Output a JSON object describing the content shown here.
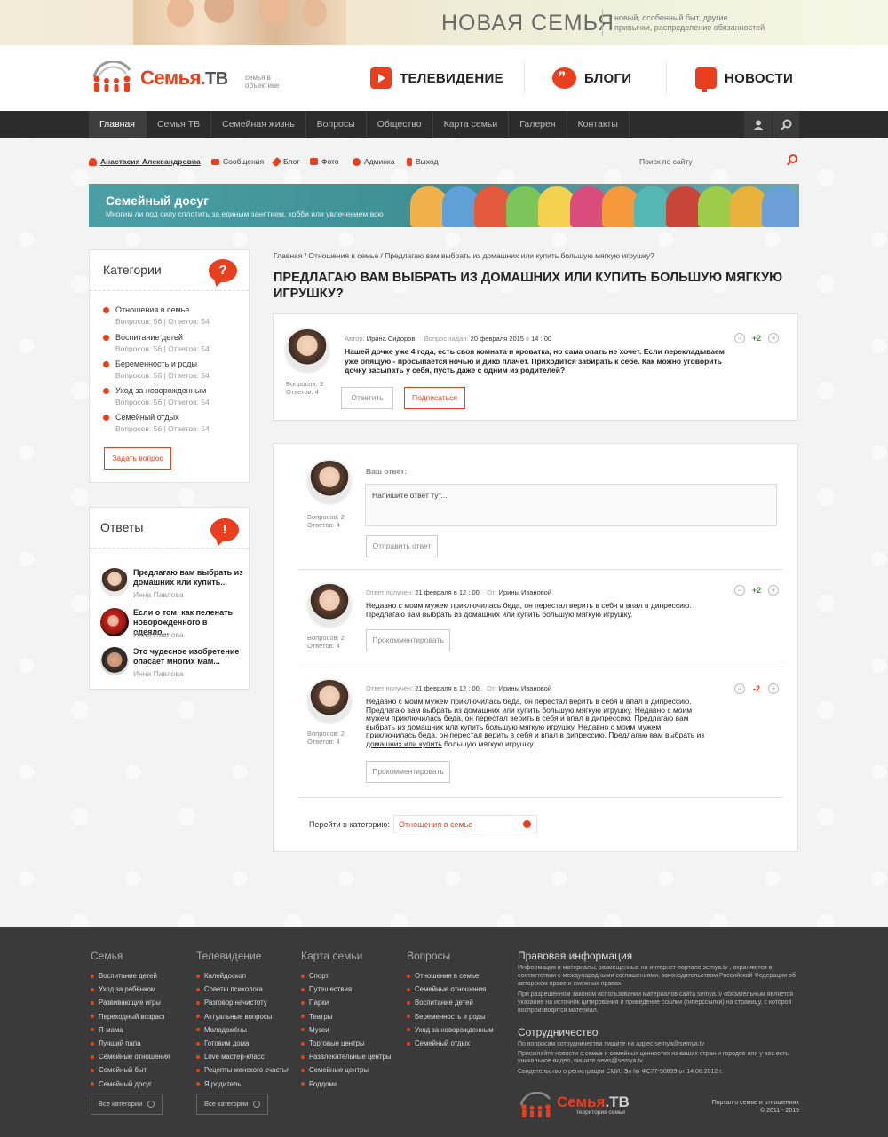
{
  "top_banner": {
    "title": "НОВАЯ СЕМЬЯ",
    "subtitle": "новый, особенный быт, другие привычки, распределение обязанностей"
  },
  "logo": {
    "brand": "Семья",
    "suffix": ".ТВ",
    "slogan": "семья в объективе"
  },
  "header_nav": [
    {
      "label": "ТЕЛЕВИДЕНИЕ",
      "icon": "tv-play-icon"
    },
    {
      "label": "БЛОГИ",
      "icon": "quote-bubble-icon"
    },
    {
      "label": "НОВОСТИ",
      "icon": "megaphone-icon"
    }
  ],
  "menu": [
    "Главная",
    "Семья ТВ",
    "Семейная жизнь",
    "Вопросы",
    "Общество",
    "Карта семьи",
    "Галерея",
    "Контакты"
  ],
  "user_bar": {
    "user": "Анастасия Александровна",
    "links": [
      "Сообщения",
      "Блог",
      "Фото",
      "Админка",
      "Выход"
    ],
    "search_placeholder": "Поиск по сайту"
  },
  "promo": {
    "title": "Семейный досуг",
    "subtitle": "Многим ли под силу сплотить за единым занятием, хобби или увлечением всю"
  },
  "categories": {
    "title": "Категории",
    "items": [
      {
        "name": "Отношения в семье",
        "stats": "Вопросов: 56 | Ответов: 54"
      },
      {
        "name": "Воспитание детей",
        "stats": "Вопросов: 56 | Ответов: 54"
      },
      {
        "name": "Беременность и роды",
        "stats": "Вопросов: 56 | Ответов: 54"
      },
      {
        "name": "Уход за новорожденным",
        "stats": "Вопросов: 56 | Ответов: 54"
      },
      {
        "name": "Семейный отдых",
        "stats": "Вопросов: 56 | Ответов: 54"
      }
    ],
    "ask_button": "Задать вопрос"
  },
  "answers_box": {
    "title": "Ответы",
    "items": [
      {
        "question": "Предлагаю вам выбрать из домашних или купить...",
        "author": "Инна Павлова"
      },
      {
        "question": "Если о том, как пеленать новорожденного в одеяло...",
        "author": "Инна Павлова"
      },
      {
        "question": "Это чудесное изобретение опасает многих мам...",
        "author": "Инна Павлова"
      }
    ]
  },
  "breadcrumbs": "Главная  /  Отношения в семье  /  Предлагаю вам выбрать из домашних или купить большую мягкую игрушку?",
  "page_title": "Предлагаю вам выбрать из домашних или купить большую мягкую игрушку?",
  "question": {
    "author_label": "Автор:",
    "author": "Ирина Сидоров",
    "date_label": "Вопрос задан:",
    "date": "20 февраля 2015",
    "time_sep": "в",
    "time": "14 : 00",
    "text": "Нашей дочке уже 4 года, есть своя комната и кроватка, но сама опать не хочет. Если перекладываем уже опящую - просыпается ночью и дико плачет. Приходится забирать к себе. Как можно уговорить дочку засыпать у себя, пусть даже с одним из родителей?",
    "stats_q": "Вопросов: 3",
    "stats_a": "Ответов: 4",
    "vote": "+2",
    "reply_button": "Ответить",
    "subscribe_button": "Подписаться"
  },
  "answer_form": {
    "label": "Ваш ответ:",
    "placeholder": "Напишите ответ тут...",
    "submit": "Отправить ответ",
    "stats_q": "Вопросов: 2",
    "stats_a": "Ответов: 4"
  },
  "answers": [
    {
      "received_label": "Ответ получен:",
      "date": "21 февраля в 12 : 00",
      "from_label": "От:",
      "from": "Ирины Ивановой",
      "text": "Недавно с моим мужем приключилась беда, он перестал верить в себя и впал в дипрессию. Предлагаю вам выбрать из домашних или купить большую мягкую игрушку.",
      "vote": "+2",
      "stats_q": "Вопросов: 2",
      "stats_a": "Ответов: 4",
      "comment_button": "Прокомментировать"
    },
    {
      "received_label": "Ответ получен:",
      "date": "21 февраля в 12 : 00",
      "from_label": "От:",
      "from": "Ирины Ивановой",
      "text_lines": [
        "Недавно с моим мужем приключилась беда, он перестал верить в себя и впал в дипрессию.",
        "Предлагаю вам выбрать из домашних или купить большую мягкую игрушку. Недавно с моим",
        "мужем приключилась беда, он перестал верить в себя и впал в дипрессию. Предлагаю вам",
        "выбрать из домашних или купить большую мягкую игрушку. Недавно с моим мужем",
        "приключилась беда, он перестал верить в себя и впал в дипрессию. Предлагаю вам выбрать из"
      ],
      "link_text": "домашних или купить",
      "text_end": " большую мягкую игрушку.",
      "vote": "-2",
      "stats_q": "Вопросов: 2",
      "stats_a": "Ответов: 4",
      "comment_button": "Прокомментировать"
    }
  ],
  "goto_category": {
    "label": "Перейти в категорию:",
    "value": "Отношения в семье"
  },
  "footer": {
    "columns": [
      {
        "title": "Семья",
        "items": [
          "Воспитание детей",
          "Уход за ребёнком",
          "Развивающие игры",
          "Переходный возраст",
          "Я-мама",
          "Лучший папа",
          "Семейные отношения",
          "Семейный быт",
          "Семейный досуг"
        ],
        "button": "Все категории"
      },
      {
        "title": "Телевидение",
        "items": [
          "Калейдоскоп",
          "Советы психолога",
          "Разговор начистоту",
          "Актуальные вопросы",
          "Молодожёны",
          "Готовим дома",
          "Love мастер-класс",
          "Рецепты женского счастья",
          "Я родитель"
        ],
        "button": "Все категории"
      },
      {
        "title": "Карта семьи",
        "items": [
          "Спорт",
          "Путешествия",
          "Парки",
          "Театры",
          "Музеи",
          "Торговые центры",
          "Развлекательные центры",
          "Семейные центры",
          "Роддома"
        ]
      },
      {
        "title": "Вопросы",
        "items": [
          "Отношения в семье",
          "Семейные отношения",
          "Воспитание детей",
          "Беременность и роды",
          "Уход за новорожденным",
          "Семейный отдых"
        ]
      }
    ],
    "legal_title": "Правовая информация",
    "legal_p1": "Информация и материалы, размещенные на интернет-портале semya.tv , охраняются в соответствии с международными соглашениями, законодательством Российской Федерации об авторском праве и смежных правах.",
    "legal_p2": "При разрешенном законом использовании материалов сайта semya.tv обязательным является указание на источник цитирования и приведение ссылки (гиперссылки) на страницу, с которой воспроизводятся материал.",
    "coop_title": "Сотрудничество",
    "coop_p1": "По вопросам сотрудничества пишите на адрес semya@semya.tv",
    "coop_p2": "Присылайте новости о семье и семейных ценностях из ваших стран и городов или у вас есть уникальное видео, пишите news@semya.tv",
    "coop_p3": "Свидетельство о регистрации СМИ: Эл № ФС77-50839 от 14.08.2012 г.",
    "logo_brand": "Семья",
    "logo_suffix": ".ТВ",
    "logo_tag": "территория семьи",
    "copyright_1": "Портал о семье и отношениях",
    "copyright_2": "© 2011 - 2015"
  },
  "colors": {
    "accent": "#e8401f",
    "menu_bg": "#2c2c2c",
    "footer_bg": "#3a3a3a",
    "positive": "#2f9e27"
  }
}
